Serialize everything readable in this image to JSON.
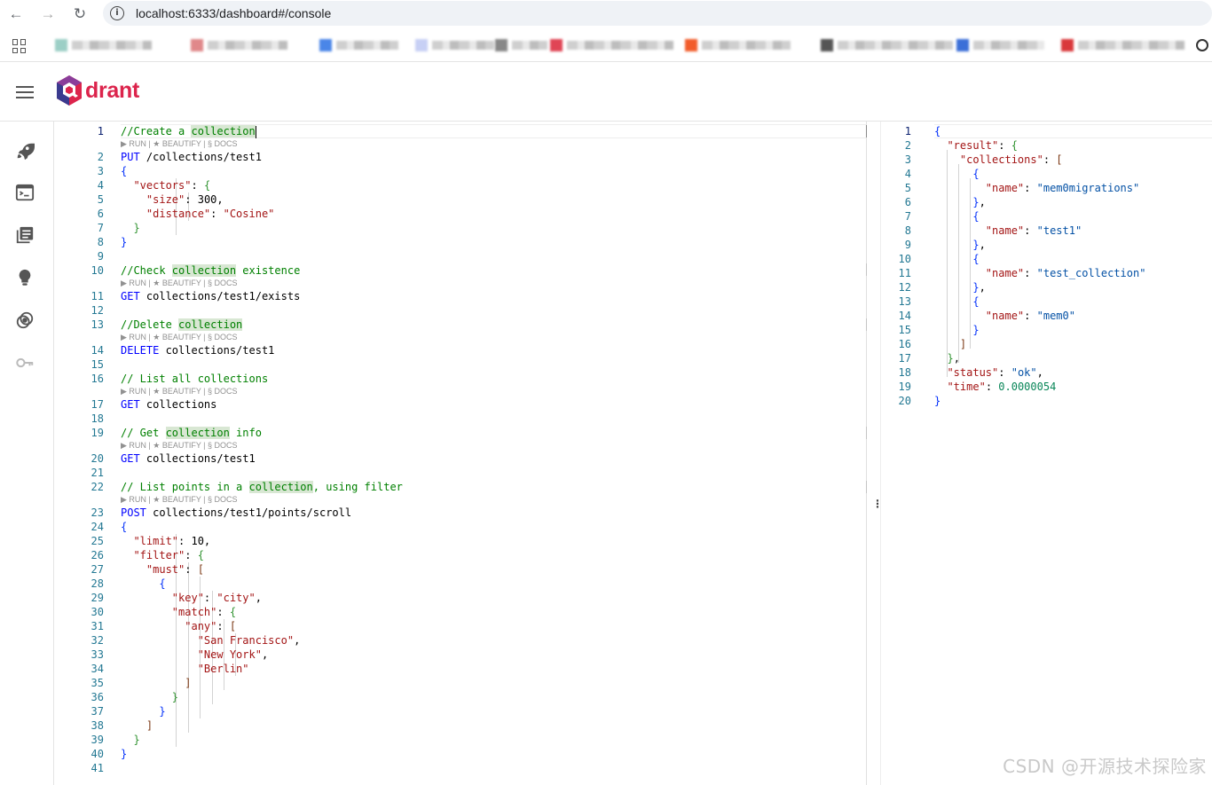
{
  "browser": {
    "url": "localhost:6333/dashboard#/console",
    "back_icon": "←",
    "forward_icon": "→",
    "reload_icon": "↻"
  },
  "app": {
    "logo_text": "drant",
    "brand_color": "#dc244c"
  },
  "sidebar": {
    "items": [
      "rocket-icon",
      "console-icon",
      "collections-icon",
      "bulb-icon",
      "datasets-icon",
      "key-icon"
    ]
  },
  "editor": {
    "codelens": "▶ RUN | ★ BEAUTIFY | § DOCS",
    "line_numbers": [
      "1",
      "2",
      "3",
      "4",
      "5",
      "6",
      "7",
      "8",
      "9",
      "10",
      "11",
      "12",
      "13",
      "14",
      "15",
      "16",
      "17",
      "18",
      "19",
      "20",
      "21",
      "22",
      "23",
      "24",
      "25",
      "26",
      "27",
      "28",
      "29",
      "30",
      "31",
      "32",
      "33",
      "34",
      "35",
      "36",
      "37",
      "38",
      "39",
      "40",
      "41"
    ]
  },
  "result": {
    "line_numbers": [
      "1",
      "2",
      "3",
      "4",
      "5",
      "6",
      "7",
      "8",
      "9",
      "10",
      "11",
      "12",
      "13",
      "14",
      "15",
      "16",
      "17",
      "18",
      "19",
      "20"
    ],
    "collections": [
      "mem0migrations",
      "test1",
      "test_collection",
      "mem0"
    ],
    "status": "ok",
    "time": "0.0000054"
  },
  "watermark": "CSDN @开源技术探险家"
}
